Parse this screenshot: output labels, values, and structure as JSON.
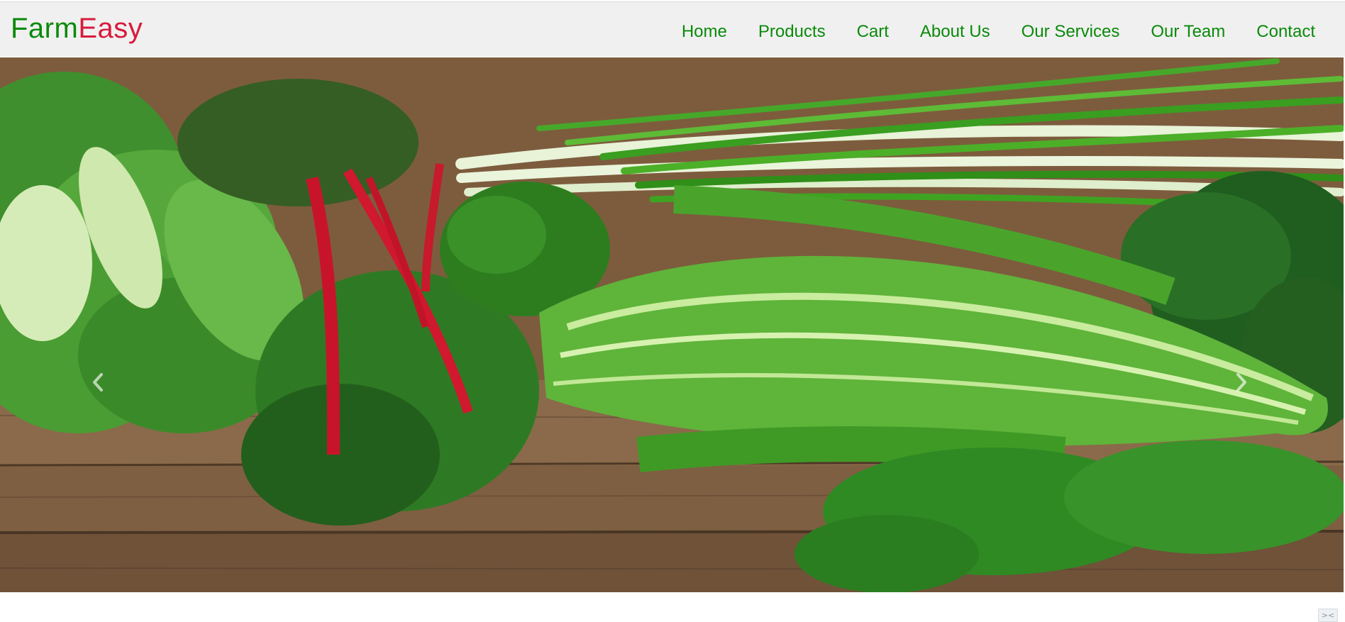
{
  "brand": {
    "part1": "Farm",
    "part2": "Easy",
    "color1": "#0a8a0a",
    "color2": "#d81b3c"
  },
  "nav": {
    "items": [
      {
        "label": "Home"
      },
      {
        "label": "Products"
      },
      {
        "label": "Cart"
      },
      {
        "label": "About Us"
      },
      {
        "label": "Our Services"
      },
      {
        "label": "Our Team"
      },
      {
        "label": "Contact"
      }
    ],
    "color": "#0a8a0a"
  },
  "hero": {
    "image_description_icon": "leafy-greens-photo",
    "prev_icon": "chevron-left-icon",
    "next_icon": "chevron-right-icon"
  },
  "corner_widget": {
    "icon": "collapse-arrows-icon"
  }
}
